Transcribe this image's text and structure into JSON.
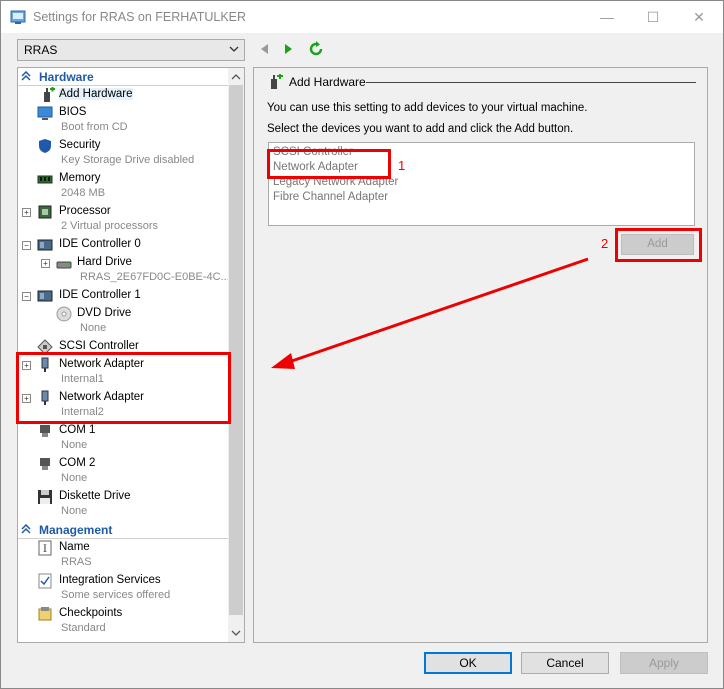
{
  "window": {
    "title": "Settings for RRAS on FERHATULKER",
    "minimize_glyph": "—",
    "maximize_glyph": "☐",
    "close_glyph": "✕"
  },
  "vm_selector": {
    "value": "RRAS"
  },
  "tree": {
    "hardware_heading": "Hardware",
    "management_heading": "Management",
    "items": [
      {
        "name": "Add Hardware",
        "sub": "",
        "icon": "add-hardware-icon"
      },
      {
        "name": "BIOS",
        "sub": "Boot from CD",
        "icon": "bios-icon"
      },
      {
        "name": "Security",
        "sub": "Key Storage Drive disabled",
        "icon": "shield-icon"
      },
      {
        "name": "Memory",
        "sub": "2048 MB",
        "icon": "memory-icon"
      },
      {
        "name": "Processor",
        "sub": "2 Virtual processors",
        "icon": "processor-icon",
        "expander": "+"
      },
      {
        "name": "IDE Controller 0",
        "sub": "",
        "icon": "ide-controller-icon",
        "expander": "−"
      },
      {
        "name": "Hard Drive",
        "sub": "RRAS_2E67FD0C-E0BE-4C...",
        "icon": "hard-drive-icon",
        "expander": "+"
      },
      {
        "name": "IDE Controller 1",
        "sub": "",
        "icon": "ide-controller-icon",
        "expander": "−"
      },
      {
        "name": "DVD Drive",
        "sub": "None",
        "icon": "dvd-drive-icon"
      },
      {
        "name": "SCSI Controller",
        "sub": "",
        "icon": "scsi-controller-icon"
      },
      {
        "name": "Network Adapter",
        "sub": "Internal1",
        "icon": "network-adapter-icon",
        "expander": "+"
      },
      {
        "name": "Network Adapter",
        "sub": "Internal2",
        "icon": "network-adapter-icon",
        "expander": "+"
      },
      {
        "name": "COM 1",
        "sub": "None",
        "icon": "com-port-icon"
      },
      {
        "name": "COM 2",
        "sub": "None",
        "icon": "com-port-icon"
      },
      {
        "name": "Diskette Drive",
        "sub": "None",
        "icon": "diskette-icon"
      }
    ],
    "management_items": [
      {
        "name": "Name",
        "sub": "RRAS",
        "icon": "name-icon"
      },
      {
        "name": "Integration Services",
        "sub": "Some services offered",
        "icon": "integration-services-icon"
      },
      {
        "name": "Checkpoints",
        "sub": "Standard",
        "icon": "checkpoints-icon"
      }
    ]
  },
  "panel": {
    "title": "Add Hardware",
    "info_line1": "You can use this setting to add devices to your virtual machine.",
    "info_line2": "Select the devices you want to add and click the Add button.",
    "devices": [
      "SCSI Controller",
      "Network Adapter",
      "Legacy Network Adapter",
      "Fibre Channel Adapter"
    ],
    "add_button": "Add"
  },
  "buttons": {
    "ok": "OK",
    "cancel": "Cancel",
    "apply": "Apply"
  },
  "annotations": {
    "label1": "1",
    "label2": "2"
  },
  "colors": {
    "annotation": "#e00000",
    "accent": "#0078d7",
    "heading": "#1e5aa8"
  }
}
